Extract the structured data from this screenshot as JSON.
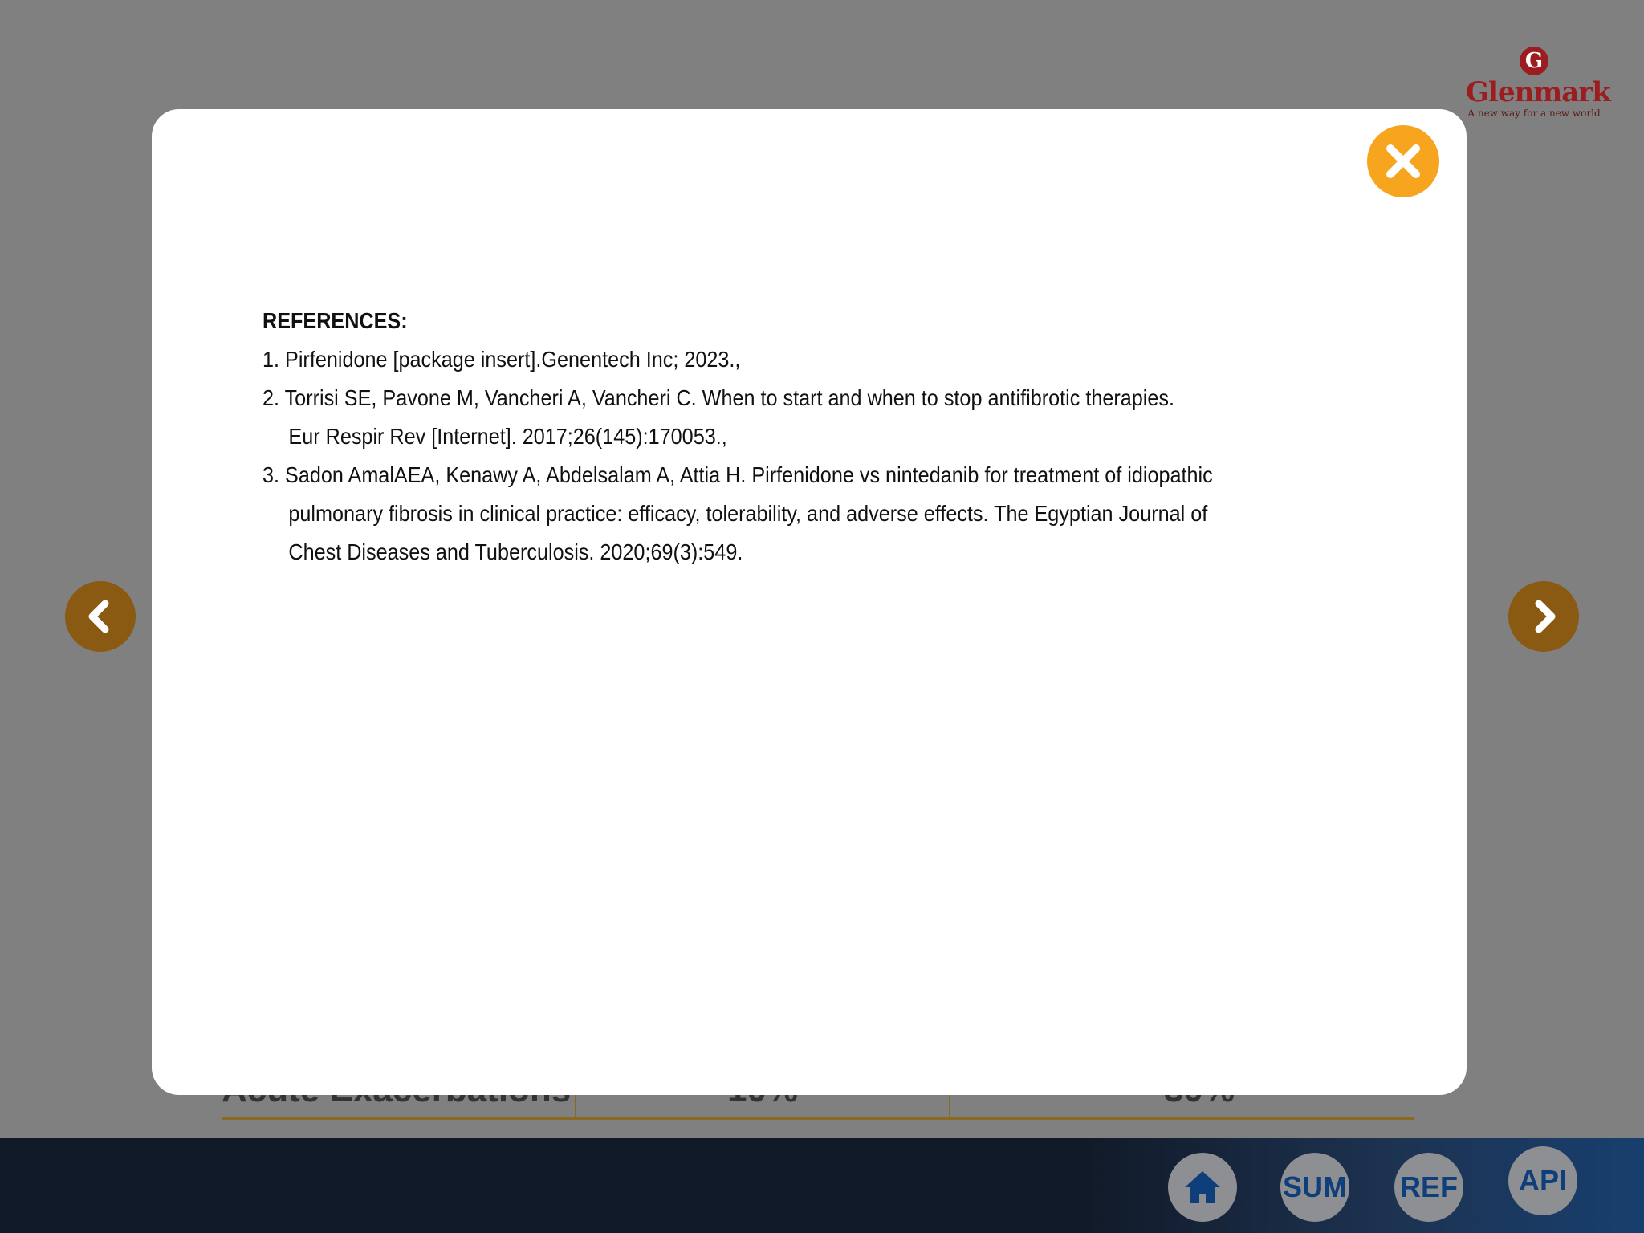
{
  "brand": {
    "mark": "G",
    "name": "Glenmark",
    "tagline": "A new way for a new world"
  },
  "background_table": {
    "row_label": "Acute Exacerbations",
    "col1_value": "10%",
    "col2_value": "30%"
  },
  "navigation": {
    "prev_icon": "chevron-left-icon",
    "next_icon": "chevron-right-icon"
  },
  "bottom_bar": {
    "home_icon": "home-icon",
    "sum_label": "SUM",
    "ref_label": "REF",
    "api_label": "API"
  },
  "modal": {
    "close_icon": "close-icon",
    "title": "REFERENCES:",
    "references": [
      {
        "number": "1.",
        "lines": [
          "Pirfenidone [package insert].Genentech Inc; 2023.,"
        ]
      },
      {
        "number": "2.",
        "lines": [
          "Torrisi SE, Pavone M, Vancheri A, Vancheri C. When to start and when to stop antifibrotic therapies.",
          "Eur Respir Rev [Internet]. 2017;26(145):170053.,"
        ]
      },
      {
        "number": "3.",
        "lines": [
          "Sadon AmalAEA, Kenawy A, Abdelsalam A, Attia H. Pirfenidone vs nintedanib for treatment of idiopathic",
          "pulmonary fibrosis in clinical practice: efficacy, tolerability, and adverse effects. The Egyptian Journal of",
          "Chest Diseases and Tuberculosis. 2020;69(3):549."
        ]
      }
    ]
  },
  "colors": {
    "overlay": "#808080",
    "close_button": "#f7a51f",
    "nav_arrow": "#8a5a12",
    "bottom_bar": "#111a28",
    "button_text": "#0f3f7a",
    "brand": "#9b1d20"
  }
}
